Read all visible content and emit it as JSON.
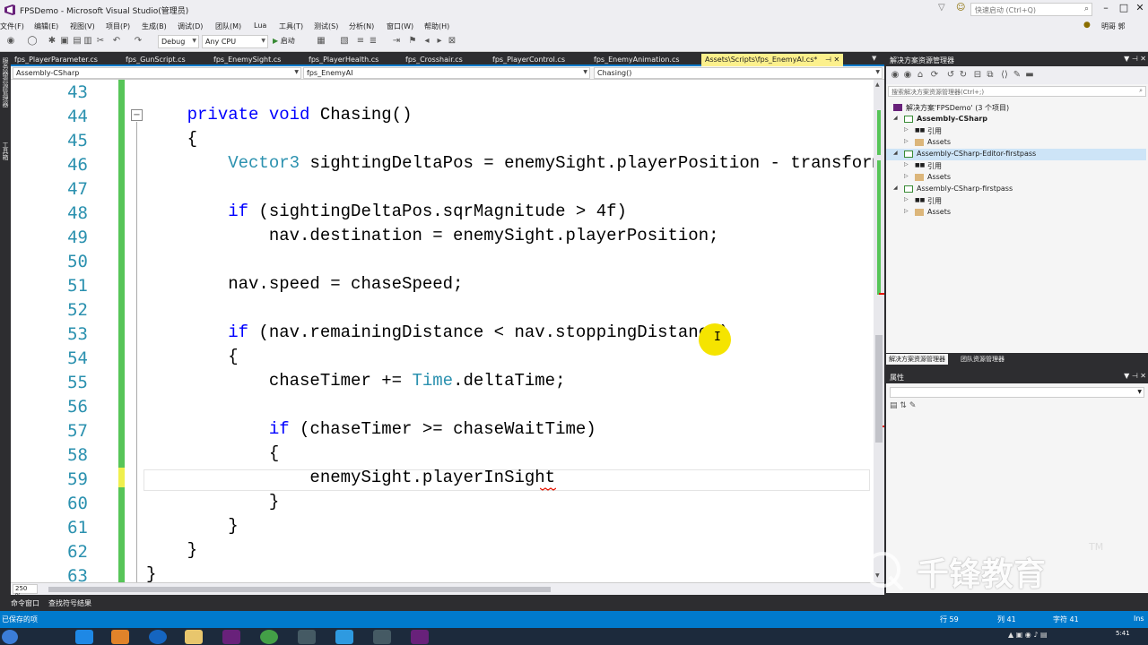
{
  "window": {
    "title": "FPSDemo - Microsoft Visual Studio(管理员)",
    "quick_launch_placeholder": "快速启动 (Ctrl+Q)",
    "user": "明哥 郭"
  },
  "menu": [
    "文件(F)",
    "编辑(E)",
    "视图(V)",
    "项目(P)",
    "生成(B)",
    "调试(D)",
    "团队(M)",
    "Lua",
    "工具(T)",
    "测试(S)",
    "分析(N)",
    "窗口(W)",
    "帮助(H)"
  ],
  "toolbar": {
    "config": "Debug",
    "platform": "Any CPU",
    "start": "启动"
  },
  "tabs": [
    {
      "label": "fps_PlayerParameter.cs",
      "active": false
    },
    {
      "label": "fps_GunScript.cs",
      "active": false
    },
    {
      "label": "fps_EnemySight.cs",
      "active": false
    },
    {
      "label": "fps_PlayerHealth.cs",
      "active": false
    },
    {
      "label": "fps_Crosshair.cs",
      "active": false
    },
    {
      "label": "fps_PlayerControl.cs",
      "active": false
    },
    {
      "label": "fps_EnemyAnimation.cs",
      "active": false
    },
    {
      "label": "Assets\\Scripts\\fps_EnemyAI.cs*",
      "active": true
    }
  ],
  "nav": {
    "project": "Assembly-CSharp",
    "class": "fps_EnemyAI",
    "member": "Chasing()"
  },
  "editor": {
    "line_numbers": [
      "43",
      "44",
      "45",
      "46",
      "47",
      "48",
      "49",
      "50",
      "51",
      "52",
      "53",
      "54",
      "55",
      "56",
      "57",
      "58",
      "59",
      "60",
      "61",
      "62",
      "63"
    ],
    "zoom": "250 %"
  },
  "left_strip": [
    "服务器资源管理器",
    "工具箱"
  ],
  "bottom_tabs": [
    "命令窗口",
    "查找符号结果"
  ],
  "status": {
    "message": "已保存的项",
    "row": "行 59",
    "col": "列 41",
    "char": "字符 41",
    "mode": "Ins"
  },
  "solution_explorer": {
    "title": "解决方案资源管理器",
    "search_placeholder": "搜索解决方案资源管理器(Ctrl+;)",
    "root": "解决方案'FPSDemo' (3 个项目)",
    "items": [
      {
        "label": "Assembly-CSharp",
        "level": 1,
        "kind": "project",
        "bold": true
      },
      {
        "label": "引用",
        "level": 2,
        "kind": "ref"
      },
      {
        "label": "Assets",
        "level": 2,
        "kind": "folder"
      },
      {
        "label": "Assembly-CSharp-Editor-firstpass",
        "level": 1,
        "kind": "project",
        "selected": true
      },
      {
        "label": "引用",
        "level": 2,
        "kind": "ref"
      },
      {
        "label": "Assets",
        "level": 2,
        "kind": "folder"
      },
      {
        "label": "Assembly-CSharp-firstpass",
        "level": 1,
        "kind": "project"
      },
      {
        "label": "引用",
        "level": 2,
        "kind": "ref"
      },
      {
        "label": "Assets",
        "level": 2,
        "kind": "folder"
      }
    ],
    "bottom_tabs": [
      "解决方案资源管理器",
      "团队资源管理器"
    ]
  },
  "properties": {
    "title": "属性"
  },
  "taskbar": {
    "time": "5:41"
  },
  "watermark": {
    "text": "千锋教育",
    "tm": "TM"
  },
  "colors": {
    "accent": "#007acc",
    "keyword": "#0000ff",
    "type": "#2b91af",
    "change_bar": "#57c558",
    "cursor_highlight": "#f5e400"
  }
}
